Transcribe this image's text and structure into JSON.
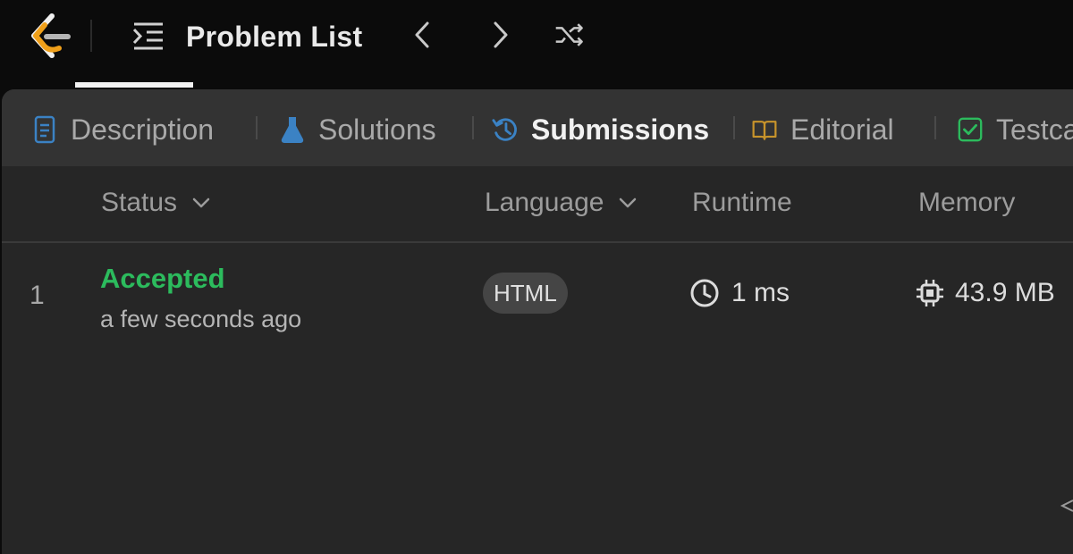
{
  "nav": {
    "logo_icon": "leetcode-logo-icon",
    "problem_list_label": "Problem List",
    "problem_list_icon": "list-indent-icon",
    "prev_icon": "chevron-left-icon",
    "next_icon": "chevron-right-icon",
    "shuffle_icon": "shuffle-icon"
  },
  "tabs": [
    {
      "label": "Description",
      "icon": "document-icon",
      "color": "#3b82c4",
      "active": false
    },
    {
      "label": "Solutions",
      "icon": "flask-icon",
      "color": "#3b82c4",
      "active": false
    },
    {
      "label": "Submissions",
      "icon": "history-icon",
      "color": "#3b82c4",
      "active": true
    },
    {
      "label": "Editorial",
      "icon": "book-icon",
      "color": "#c8942b",
      "active": false
    },
    {
      "label": "Testca",
      "icon": "checkbox-icon",
      "color": "#2cbb5d",
      "active": false
    }
  ],
  "table": {
    "headers": {
      "status": "Status",
      "language": "Language",
      "runtime": "Runtime",
      "memory": "Memory"
    },
    "rows": [
      {
        "index": "1",
        "status": "Accepted",
        "status_color": "#2cbb5d",
        "time": "a few seconds ago",
        "language": "HTML",
        "runtime": "1 ms",
        "runtime_icon": "clock-icon",
        "memory": "43.9 MB",
        "memory_icon": "chip-icon"
      }
    ]
  }
}
